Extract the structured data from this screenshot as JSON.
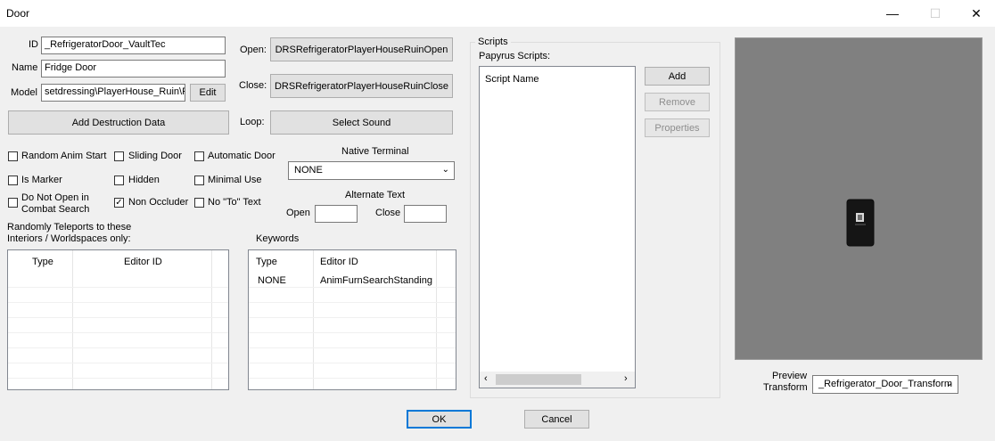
{
  "window": {
    "title": "Door",
    "minimize": "—",
    "maximize": "☐",
    "close": "✕"
  },
  "fields": {
    "id_label": "ID",
    "id_value": "_RefrigeratorDoor_VaultTec",
    "name_label": "Name",
    "name_value": "Fridge Door",
    "model_label": "Model",
    "model_value": "setdressing\\PlayerHouse_Ruin\\F",
    "edit_label": "Edit"
  },
  "sounds": {
    "open_label": "Open:",
    "open_value": "DRSRefrigeratorPlayerHouseRuinOpen",
    "close_label": "Close:",
    "close_value": "DRSRefrigeratorPlayerHouseRuinClose",
    "loop_label": "Loop:",
    "loop_value": "Select Sound"
  },
  "add_destruction_label": "Add Destruction Data",
  "flags": {
    "random_anim_start": {
      "label": "Random Anim Start",
      "checked": false
    },
    "sliding_door": {
      "label": "Sliding Door",
      "checked": false
    },
    "automatic_door": {
      "label": "Automatic Door",
      "checked": false
    },
    "is_marker": {
      "label": "Is Marker",
      "checked": false
    },
    "hidden": {
      "label": "Hidden",
      "checked": false
    },
    "minimal_use": {
      "label": "Minimal Use",
      "checked": false
    },
    "do_not_open_line1": "Do Not Open in",
    "do_not_open_line2": "Combat Search",
    "do_not_open_checked": false,
    "non_occluder": {
      "label": "Non Occluder",
      "checked": true
    },
    "no_to_text": {
      "label": "No \"To\" Text",
      "checked": false
    }
  },
  "native_terminal": {
    "label": "Native Terminal",
    "value": "NONE"
  },
  "alternate_text": {
    "label": "Alternate Text",
    "open_label": "Open",
    "open_value": "",
    "close_label": "Close",
    "close_value": ""
  },
  "teleports": {
    "label_line1": "Randomly Teleports to these",
    "label_line2": "Interiors / Worldspaces only:",
    "columns": [
      "Type",
      "Editor ID"
    ]
  },
  "keywords": {
    "label": "Keywords",
    "columns": [
      "Type",
      "Editor ID"
    ],
    "rows": [
      {
        "type": "NONE",
        "editor_id": "AnimFurnSearchStanding"
      }
    ]
  },
  "scripts": {
    "group_label": "Scripts",
    "papyrus_label": "Papyrus Scripts:",
    "column": "Script Name",
    "add": "Add",
    "remove": "Remove",
    "properties": "Properties"
  },
  "preview": {
    "label_line1": "Preview",
    "label_line2": "Transform",
    "value": "_Refrigerator_Door_Transform"
  },
  "footer": {
    "ok": "OK",
    "cancel": "Cancel"
  },
  "colors": {
    "preview_bg": "#808080",
    "accent": "#0078d7"
  }
}
